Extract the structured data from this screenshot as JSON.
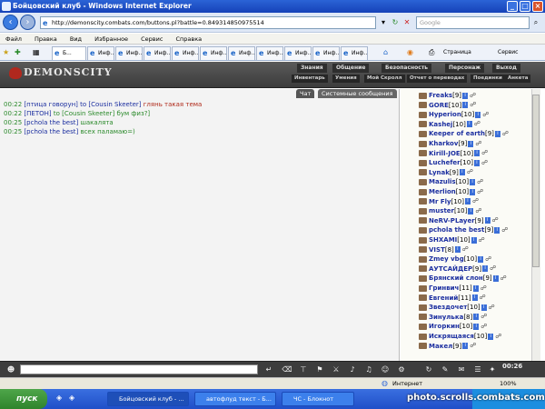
{
  "window": {
    "title": "Бойцовский клуб - Windows Internet Explorer"
  },
  "address": {
    "url": "http://demonscity.combats.com/buttons.pl?battle=0.849314850975514",
    "search_placeholder": "Google"
  },
  "menu": [
    "Файл",
    "Правка",
    "Вид",
    "Избранное",
    "Сервис",
    "Справка"
  ],
  "tabs": [
    "Б...",
    "Инф...",
    "Инф...",
    "Инф...",
    "Инф...",
    "Инф...",
    "Инф...",
    "Инф...",
    "Инф...",
    "Инф...",
    "Инф..."
  ],
  "toolbar": {
    "page": "Страница",
    "tools": "Сервис"
  },
  "game": {
    "logo": "DEMONSCITY",
    "nav1": [
      "Знания",
      "Общение",
      "Безопасность",
      "Персонаж",
      "Выход"
    ],
    "nav2": [
      "Инвентарь",
      "Умения",
      "Мой Скролл",
      "Отчет о переводах",
      "Поединки",
      "Анкета"
    ]
  },
  "chat": {
    "tabs": [
      "Чат",
      "Системные сообщения"
    ],
    "messages": [
      {
        "time": "00:22",
        "from": "[птица говорун]",
        "to": "to [Cousin Skeeter]",
        "text": "глянь такая тема",
        "color": "red"
      },
      {
        "time": "00:22",
        "from": "[ПЕТОН]",
        "to": "to [Cousin Skeeter]",
        "text": "бум физ?]",
        "color": "green"
      },
      {
        "time": "00:25",
        "from": "[pchola the best]",
        "to": "",
        "text": "шакалята",
        "color": "green"
      },
      {
        "time": "00:25",
        "from": "[pchola the best]",
        "to": "",
        "text": "всех паламаю=)",
        "color": "green"
      }
    ]
  },
  "users": [
    {
      "name": "Freaks",
      "lvl": "[9]"
    },
    {
      "name": "GORE",
      "lvl": "[10]"
    },
    {
      "name": "Hyperion",
      "lvl": "[10]"
    },
    {
      "name": "Kashej",
      "lvl": "[10]"
    },
    {
      "name": "Keeper of earth",
      "lvl": "[9]"
    },
    {
      "name": "Kharkov",
      "lvl": "[9]"
    },
    {
      "name": "Kirill-JOE",
      "lvl": "[10]"
    },
    {
      "name": "Luchefer",
      "lvl": "[10]"
    },
    {
      "name": "Lynak",
      "lvl": "[9]"
    },
    {
      "name": "Mazulis",
      "lvl": "[10]"
    },
    {
      "name": "Merlion",
      "lvl": "[10]"
    },
    {
      "name": "Mr Fly",
      "lvl": "[10]"
    },
    {
      "name": "muster",
      "lvl": "[10]"
    },
    {
      "name": "NeRV-PLayer",
      "lvl": "[9]"
    },
    {
      "name": "pchola the best",
      "lvl": "[9]"
    },
    {
      "name": "SHXAMI",
      "lvl": "[10]"
    },
    {
      "name": "VIST",
      "lvl": "[8]"
    },
    {
      "name": "Zmey vbg",
      "lvl": "[10]"
    },
    {
      "name": "АУТСАЙДЕР",
      "lvl": "[9]"
    },
    {
      "name": "Брянский слон",
      "lvl": "[9]"
    },
    {
      "name": "Гринвич",
      "lvl": "[11]"
    },
    {
      "name": "Евгений",
      "lvl": "[11]"
    },
    {
      "name": "Звездочет",
      "lvl": "[10]"
    },
    {
      "name": "Зинулька",
      "lvl": "[8]"
    },
    {
      "name": "Игоркин",
      "lvl": "[10]"
    },
    {
      "name": "Искрящаяся",
      "lvl": "[10]"
    },
    {
      "name": "Макел",
      "lvl": "[9]"
    }
  ],
  "clock": "00:26",
  "status": {
    "zone": "Интернет",
    "zoom": "100%"
  },
  "taskbar": {
    "start": "пуск",
    "items": [
      "Бойцовский клуб - ...",
      "автофлуд текст - Б...",
      "ЧС - Блокнот"
    ],
    "watermark": "photo.scrolls.combats.com"
  }
}
